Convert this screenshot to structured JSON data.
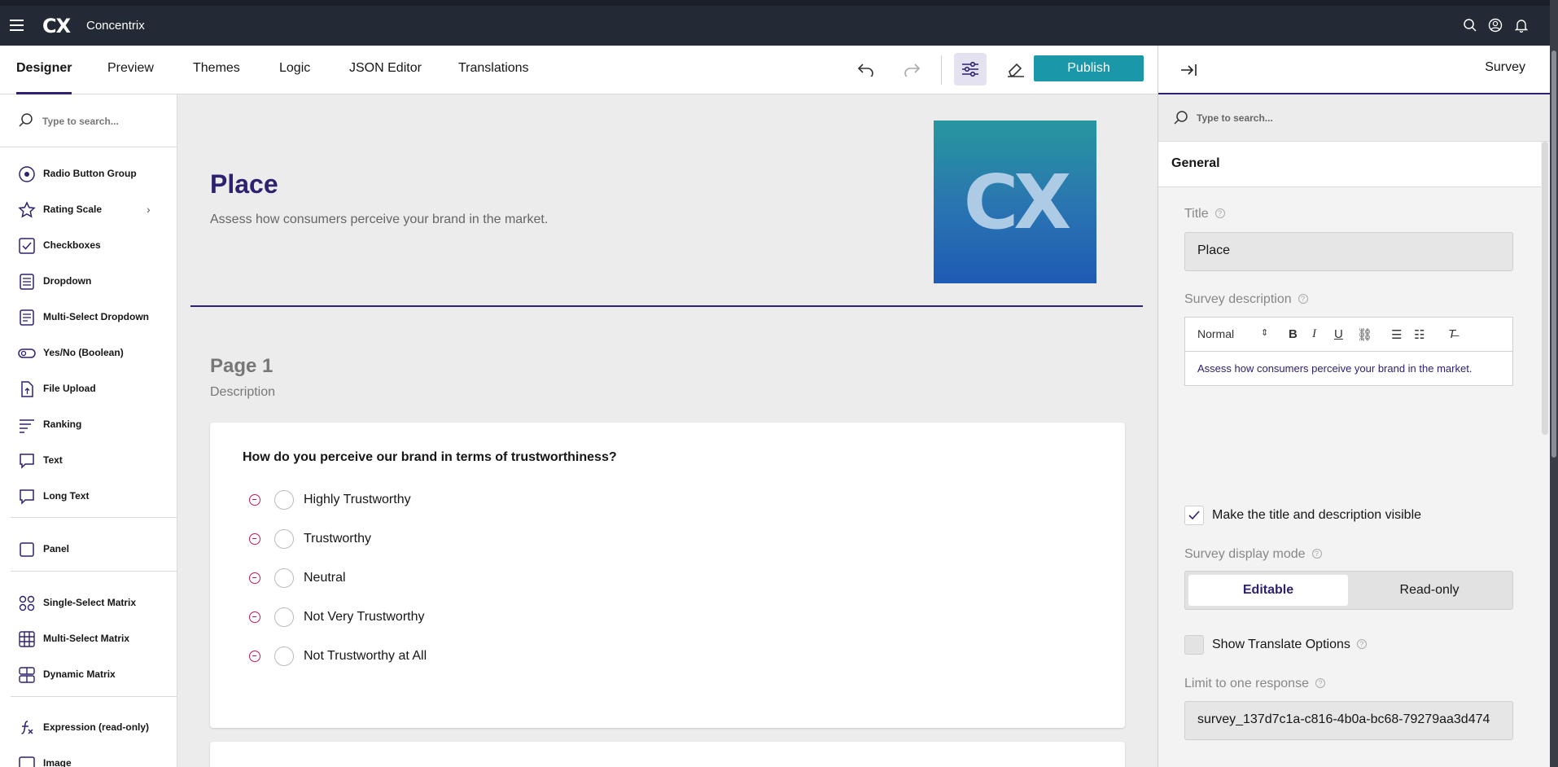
{
  "app": {
    "logo": "CX",
    "name": "Concentrix"
  },
  "tabs": [
    {
      "label": "Designer",
      "active": true
    },
    {
      "label": "Preview"
    },
    {
      "label": "Themes"
    },
    {
      "label": "Logic"
    },
    {
      "label": "JSON Editor"
    },
    {
      "label": "Translations"
    }
  ],
  "toolbar": {
    "publish_label": "Publish"
  },
  "toolbox": {
    "search_placeholder": "Type to search...",
    "items": [
      {
        "label": "Radio Button Group",
        "icon": "radio-icon"
      },
      {
        "label": "Rating Scale",
        "icon": "star-icon"
      },
      {
        "label": "Checkboxes",
        "icon": "checkbox-icon"
      },
      {
        "label": "Dropdown",
        "icon": "dropdown-icon"
      },
      {
        "label": "Multi-Select Dropdown",
        "icon": "multi-dropdown-icon"
      },
      {
        "label": "Yes/No (Boolean)",
        "icon": "toggle-icon"
      },
      {
        "label": "File Upload",
        "icon": "file-upload-icon"
      },
      {
        "label": "Ranking",
        "icon": "ranking-icon"
      },
      {
        "label": "Text",
        "icon": "text-icon"
      },
      {
        "label": "Long Text",
        "icon": "long-text-icon"
      },
      {
        "label": "Panel",
        "icon": "panel-icon"
      },
      {
        "label": "Single-Select Matrix",
        "icon": "single-matrix-icon"
      },
      {
        "label": "Multi-Select Matrix",
        "icon": "multi-matrix-icon"
      },
      {
        "label": "Dynamic Matrix",
        "icon": "dynamic-matrix-icon"
      },
      {
        "label": "Expression (read-only)",
        "icon": "expression-icon"
      },
      {
        "label": "Image",
        "icon": "image-icon"
      }
    ]
  },
  "survey": {
    "title": "Place",
    "description": "Assess how consumers perceive your brand in the market.",
    "logo_text": "CX",
    "page": {
      "title": "Page 1",
      "description": "Description"
    },
    "question": {
      "title": "How do you perceive our brand in terms of trustworthiness?",
      "choices": [
        "Highly Trustworthy",
        "Trustworthy",
        "Neutral",
        "Not Very Trustworthy",
        "Not Trustworthy at All"
      ]
    }
  },
  "properties": {
    "header": "Survey",
    "search_placeholder": "Type to search...",
    "section": "General",
    "title_label": "Title",
    "title_value": "Place",
    "desc_label": "Survey description",
    "editor_format": "Normal",
    "desc_value": "Assess how consumers perceive your brand in the market.",
    "visible_label": "Make the title and description visible",
    "mode_label": "Survey display mode",
    "mode_options": [
      "Editable",
      "Read-only"
    ],
    "translate_label": "Show Translate Options",
    "limit_label": "Limit to one response",
    "limit_value": "survey_137d7c1a-c816-4b0a-bc68-79279aa3d474"
  },
  "colors": {
    "accent": "#2f2170",
    "publish": "#1a97a8",
    "remove": "#c2185b",
    "topbar": "#232a35"
  }
}
